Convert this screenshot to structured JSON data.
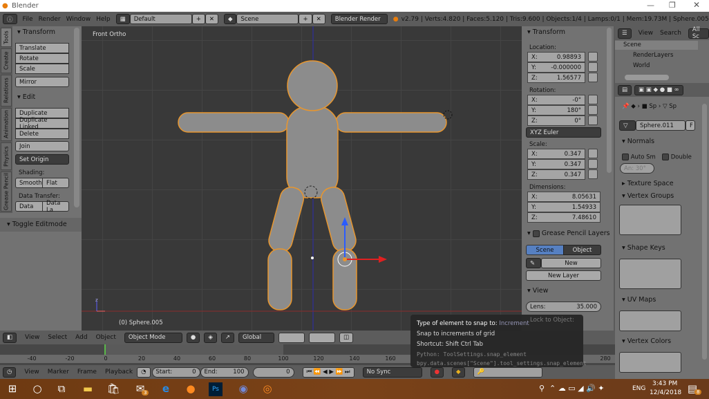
{
  "window": {
    "title": "Blender"
  },
  "menu": {
    "items": [
      "File",
      "Render",
      "Window",
      "Help"
    ],
    "layout": "Default",
    "scene": "Scene",
    "engine": "Blender Render",
    "stats": "v2.79 | Verts:4.820 | Faces:5.120 | Tris:9.600 | Objects:1/4 | Lamps:0/1 | Mem:19.73M | Sphere.005"
  },
  "shelf": {
    "tabs": [
      "Tools",
      "Create",
      "Relations",
      "Animation",
      "Physics",
      "Grease Pencil"
    ],
    "transform_title": "Transform",
    "transform_buttons": [
      "Translate",
      "Rotate",
      "Scale"
    ],
    "mirror": "Mirror",
    "edit_title": "Edit",
    "edit_buttons": [
      "Duplicate",
      "Duplicate Linked",
      "Delete"
    ],
    "join": "Join",
    "set_origin": "Set Origin",
    "shading_label": "Shading:",
    "smooth": "Smooth",
    "flat": "Flat",
    "data_transfer_label": "Data Transfer:",
    "data": "Data",
    "data_layout": "Data La",
    "toggle_editmode": "Toggle Editmode"
  },
  "viewport": {
    "view_name": "Front Ortho",
    "object_label": "(0) Sphere.005",
    "axis_z": "z",
    "axis_x": "x"
  },
  "npanel": {
    "title": "Transform",
    "location_label": "Location:",
    "location": [
      [
        "X:",
        "0.98893"
      ],
      [
        "Y:",
        "-0.000000"
      ],
      [
        "Z:",
        "1.56577"
      ]
    ],
    "rotation_label": "Rotation:",
    "rotation": [
      [
        "X:",
        "-0°"
      ],
      [
        "Y:",
        "180°"
      ],
      [
        "Z:",
        "0°"
      ]
    ],
    "rotation_mode": "XYZ Euler",
    "scale_label": "Scale:",
    "scale": [
      [
        "X:",
        "0.347"
      ],
      [
        "Y:",
        "0.347"
      ],
      [
        "Z:",
        "0.347"
      ]
    ],
    "dimensions_label": "Dimensions:",
    "dimensions": [
      [
        "X:",
        "8.05631"
      ],
      [
        "Y:",
        "1.54933"
      ],
      [
        "Z:",
        "7.48610"
      ]
    ],
    "gp_title": "Grease Pencil Layers",
    "gp_scene": "Scene",
    "gp_object": "Object",
    "gp_new": "New",
    "gp_new_layer": "New Layer",
    "view_title": "View",
    "lens_label": "Lens:",
    "lens_value": "35.000",
    "lock_to_object": "Lock to Object:"
  },
  "outliner": {
    "view": "View",
    "search": "Search",
    "all_scenes": "All Sc",
    "items": [
      "Scene",
      "RenderLayers",
      "World"
    ]
  },
  "properties": {
    "breadcrumb": [
      "Sp",
      "Sp"
    ],
    "mesh_name": "Sphere.011",
    "fake_user": "F",
    "normals_title": "Normals",
    "auto_smooth": "Auto Sm",
    "double_sided": "Double",
    "angle": "An: 30°",
    "texture_space": "Texture Space",
    "vertex_groups": "Vertex Groups",
    "shape_keys": "Shape Keys",
    "uv_maps": "UV Maps",
    "vertex_colors": "Vertex Colors"
  },
  "view3d_header": {
    "menus": [
      "View",
      "Select",
      "Add",
      "Object"
    ],
    "mode": "Object Mode",
    "orientation": "Global"
  },
  "timeline": {
    "ticks": [
      "-40",
      "-20",
      "0",
      "20",
      "40",
      "60",
      "80",
      "100",
      "120",
      "140",
      "160",
      "280"
    ],
    "menus": [
      "View",
      "Marker",
      "Frame",
      "Playback"
    ],
    "start_label": "Start:",
    "start": "0",
    "end_label": "End:",
    "end": "100",
    "current": "0",
    "sync": "No Sync"
  },
  "tooltip": {
    "line1_label": "Type of element to snap to:",
    "line1_value": "Increment",
    "line2": "Snap to increments of grid",
    "line3": "Shortcut: Shift Ctrl Tab",
    "python1": "Python: ToolSettings.snap_element",
    "python2": "bpy.data.scenes[\"Scene\"].tool_settings.snap_element"
  },
  "taskbar": {
    "time": "3:43 PM",
    "date": "12/4/2018",
    "lang": "ENG",
    "mail_badge": "3",
    "notif_badge": "8"
  },
  "colors": {
    "selection_outline": "#e8962e",
    "accent_blue": "#5680c2",
    "viewport_bg": "#393939"
  }
}
